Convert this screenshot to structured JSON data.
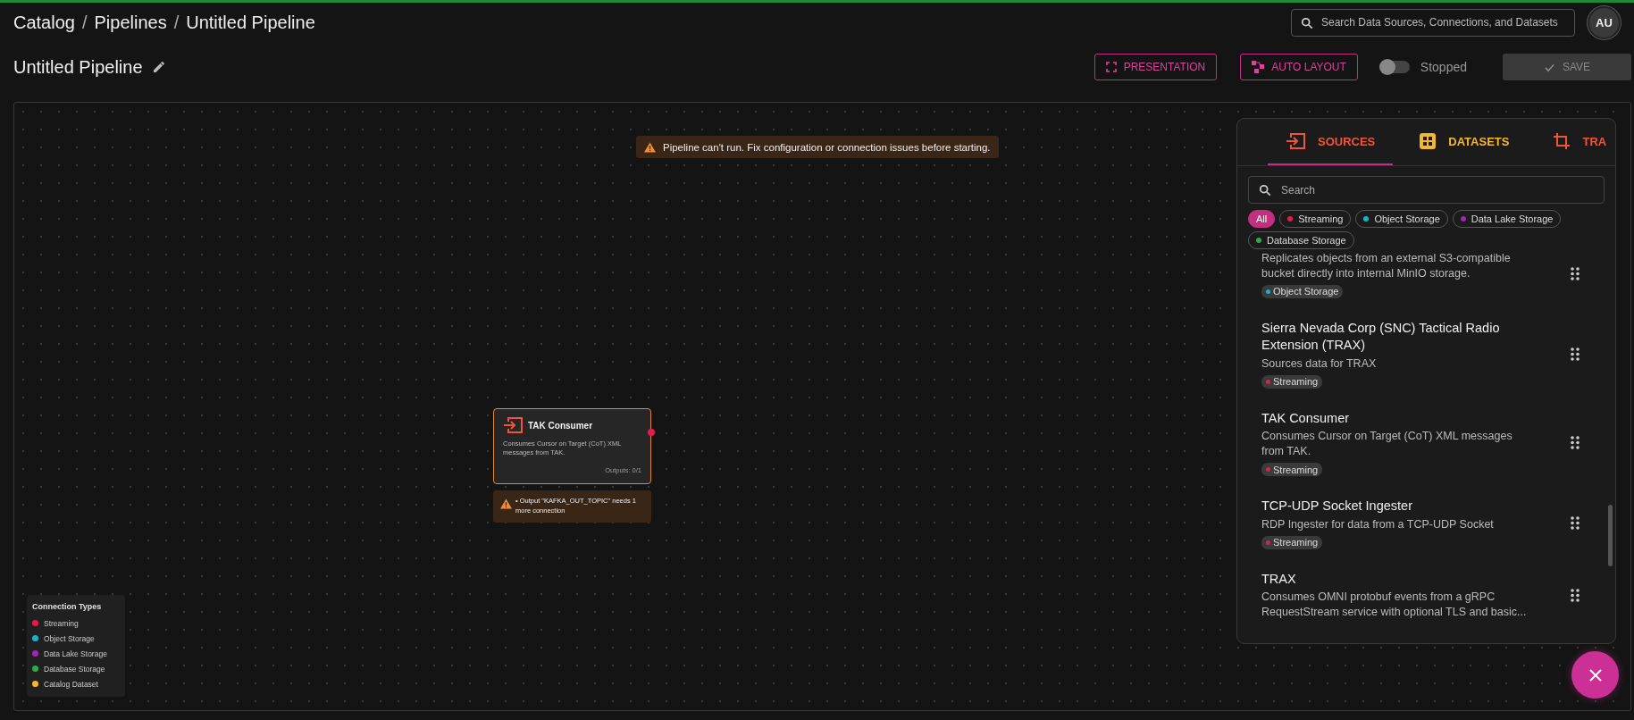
{
  "breadcrumb": [
    {
      "kind": "link",
      "text": "Catalog"
    },
    {
      "kind": "separator",
      "text": "/"
    },
    {
      "kind": "link",
      "text": "Pipelines"
    },
    {
      "kind": "separator",
      "text": "/"
    },
    {
      "kind": "current",
      "text": "Untitled Pipeline"
    }
  ],
  "global_search": {
    "placeholder": "Search Data Sources, Connections, and Datasets"
  },
  "avatar": {
    "initials": "AU"
  },
  "title": "Untitled Pipeline",
  "actions": [
    {
      "kind": "presentation",
      "label": "PRESENTATION"
    },
    {
      "kind": "layout",
      "label": "AUTO LAYOUT"
    }
  ],
  "run_toggle": {
    "on": false,
    "label": "Stopped"
  },
  "save": {
    "label": "SAVE",
    "disabled": true
  },
  "banner": "Pipeline can't run. Fix configuration or connection issues before starting.",
  "node": {
    "title": "TAK Consumer",
    "description": "Consumes Cursor on Target (CoT) XML messages from TAK.",
    "outputs": "Outputs: 0/1",
    "warning": "• Output \"KAFKA_OUT_TOPIC\" needs 1 more connection"
  },
  "legend": {
    "title": "Connection Types",
    "items": [
      {
        "label": "Streaming",
        "color": "#e8194f"
      },
      {
        "label": "Object Storage",
        "color": "#14b4d0"
      },
      {
        "label": "Data Lake Storage",
        "color": "#9c27b0"
      },
      {
        "label": "Database Storage",
        "color": "#2eaa4a"
      },
      {
        "label": "Catalog Dataset",
        "color": "#f9b62f"
      }
    ]
  },
  "panel": {
    "tabs": [
      {
        "kind": "sources",
        "label": "SOURCES",
        "selected": true,
        "color": "#f0553a"
      },
      {
        "kind": "datasets",
        "label": "DATASETS",
        "selected": false,
        "color": "#f5b82a"
      },
      {
        "kind": "transforms",
        "label": "TRA",
        "selected": false,
        "color": "#f0553a"
      }
    ],
    "search": {
      "placeholder": "Search"
    },
    "filters": [
      {
        "label": "All",
        "selected": true
      },
      {
        "label": "Streaming",
        "selected": false,
        "color": "#e8194f"
      },
      {
        "label": "Object Storage",
        "selected": false,
        "color": "#14b4d0"
      },
      {
        "label": "Data Lake Storage",
        "selected": false,
        "color": "#9c27b0"
      },
      {
        "label": "Database Storage",
        "selected": false,
        "color": "#2eaa4a"
      }
    ],
    "items": [
      {
        "description": "Replicates objects from an external S3-compatible bucket directly into internal MinIO storage.",
        "tag": {
          "label": "Object Storage",
          "color": "#14b4d0"
        }
      },
      {
        "title": "Sierra Nevada Corp (SNC) Tactical Radio Extension (TRAX)",
        "description": "Sources data for TRAX",
        "tag": {
          "label": "Streaming",
          "color": "#e8194f"
        }
      },
      {
        "title": "TAK Consumer",
        "description": "Consumes Cursor on Target (CoT) XML messages from TAK.",
        "tag": {
          "label": "Streaming",
          "color": "#e8194f"
        }
      },
      {
        "title": "TCP-UDP Socket Ingester",
        "description": "RDP Ingester for data from a TCP-UDP Socket",
        "tag": {
          "label": "Streaming",
          "color": "#e8194f"
        }
      },
      {
        "title": "TRAX",
        "description": "Consumes OMNI protobuf events from a gRPC RequestStream service with optional TLS and basic..."
      }
    ]
  }
}
